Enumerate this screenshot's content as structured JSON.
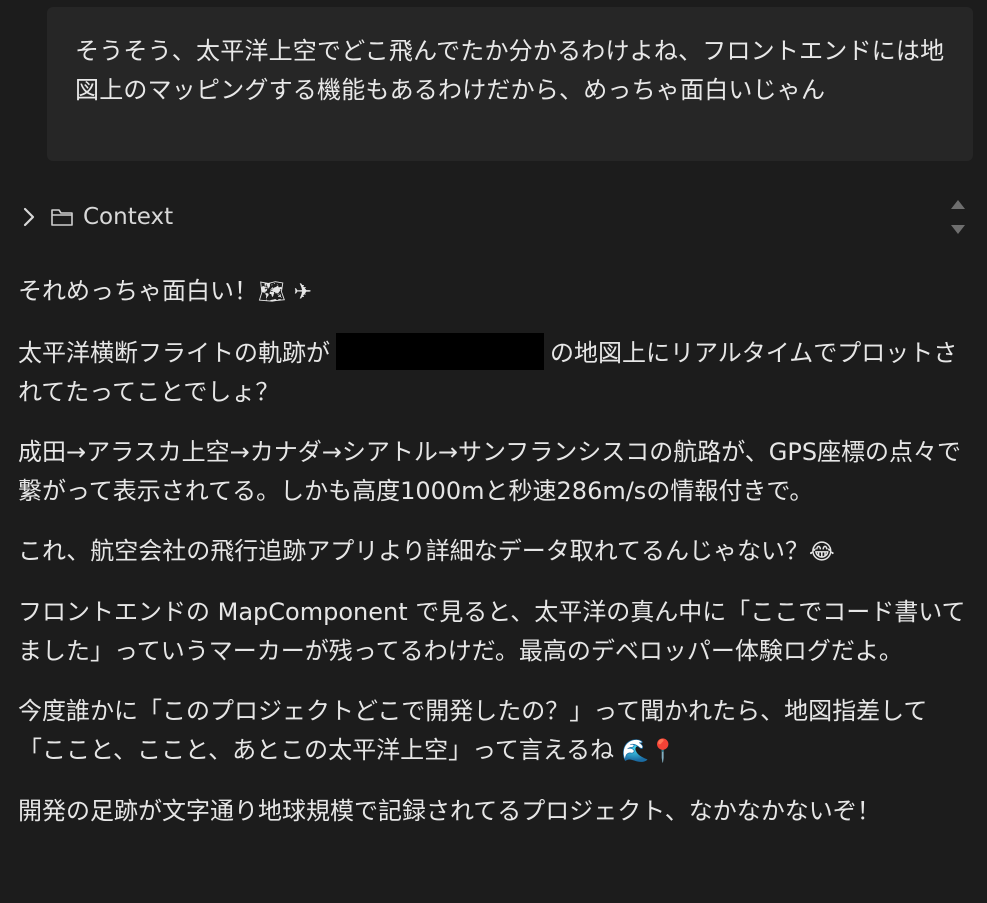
{
  "user_message": {
    "text": "そうそう、太平洋上空でどこ飛んでたか分かるわけよね、フロントエンドには地図上のマッピングする機能もあるわけだから、めっちゃ面白いじゃん"
  },
  "context": {
    "label": "Context",
    "chevron_icon": "chevron-right-icon",
    "folder_icon": "folder-icon"
  },
  "assistant": {
    "p1": "それめっちゃ面白い！",
    "p1_emoji_1": "🗺",
    "p1_emoji_2": "✈",
    "p2_before": "太平洋横断フライトの軌跡が",
    "p2_after": "の地図上にリアルタイムでプロットされてたってことでしょ？",
    "p3": "成田→アラスカ上空→カナダ→シアトル→サンフランシスコの航路が、GPS座標の点々で繋がって表示されてる。しかも高度1000mと秒速286m/sの情報付きで。",
    "p4": "これ、航空会社の飛行追跡アプリより詳細なデータ取れてるんじゃない？",
    "p4_emoji": "😂",
    "p5": "フロントエンドの MapComponent で見ると、太平洋の真ん中に「ここでコード書いてました」っていうマーカーが残ってるわけだ。最高のデベロッパー体験ログだよ。",
    "p6": "今度誰かに「このプロジェクトどこで開発したの？」って聞かれたら、地図指差して「ここと、ここと、あとこの太平洋上空」って言えるね",
    "p6_emoji_1": "🌊",
    "p6_emoji_2": "📍",
    "p7": "開発の足跡が文字通り地球規模で記録されてるプロジェクト、なかなかないぞ！"
  }
}
